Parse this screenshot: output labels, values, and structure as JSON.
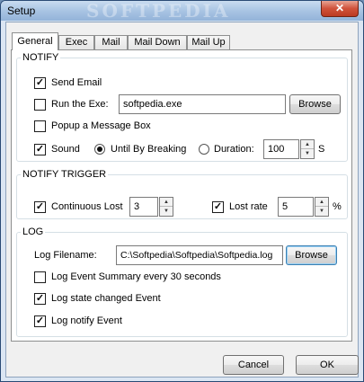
{
  "window": {
    "title": "Setup",
    "watermark": "SOFTPEDIA",
    "close_glyph": "✕"
  },
  "tabs": [
    {
      "label": "General",
      "active": true
    },
    {
      "label": "Exec",
      "active": false
    },
    {
      "label": "Mail",
      "active": false
    },
    {
      "label": "Mail Down",
      "active": false
    },
    {
      "label": "Mail Up",
      "active": false
    }
  ],
  "notify": {
    "title": "NOTIFY",
    "send_email": {
      "label": "Send Email",
      "checked": true
    },
    "run_exe": {
      "label": "Run the Exe:",
      "checked": false,
      "value": "softpedia.exe",
      "browse_label": "Browse"
    },
    "popup": {
      "label": "Popup a Message Box",
      "checked": false
    },
    "sound": {
      "label": "Sound",
      "checked": true
    },
    "until_breaking": {
      "label": "Until By Breaking",
      "selected": true
    },
    "duration": {
      "label": "Duration:",
      "selected": false,
      "value": "100",
      "unit": "S"
    }
  },
  "notify_trigger": {
    "title": "NOTIFY TRIGGER",
    "continuous_lost": {
      "label": "Continuous Lost",
      "checked": true,
      "value": "3"
    },
    "lost_rate": {
      "label": "Lost rate",
      "checked": true,
      "value": "5",
      "unit": "%"
    }
  },
  "log": {
    "title": "LOG",
    "filename_label": "Log Filename:",
    "filename_value": "C:\\Softpedia\\Softpedia\\Softpedia.log",
    "browse_label": "Browse",
    "event_summary": {
      "label": "Log Event Summary every 30 seconds",
      "checked": false
    },
    "state_changed": {
      "label": "Log state changed Event",
      "checked": true
    },
    "notify_event": {
      "label": "Log notify Event",
      "checked": true
    }
  },
  "buttons": {
    "cancel": "Cancel",
    "ok": "OK"
  },
  "glyphs": {
    "check": "✓",
    "spin_up": "▲",
    "spin_down": "▼"
  }
}
